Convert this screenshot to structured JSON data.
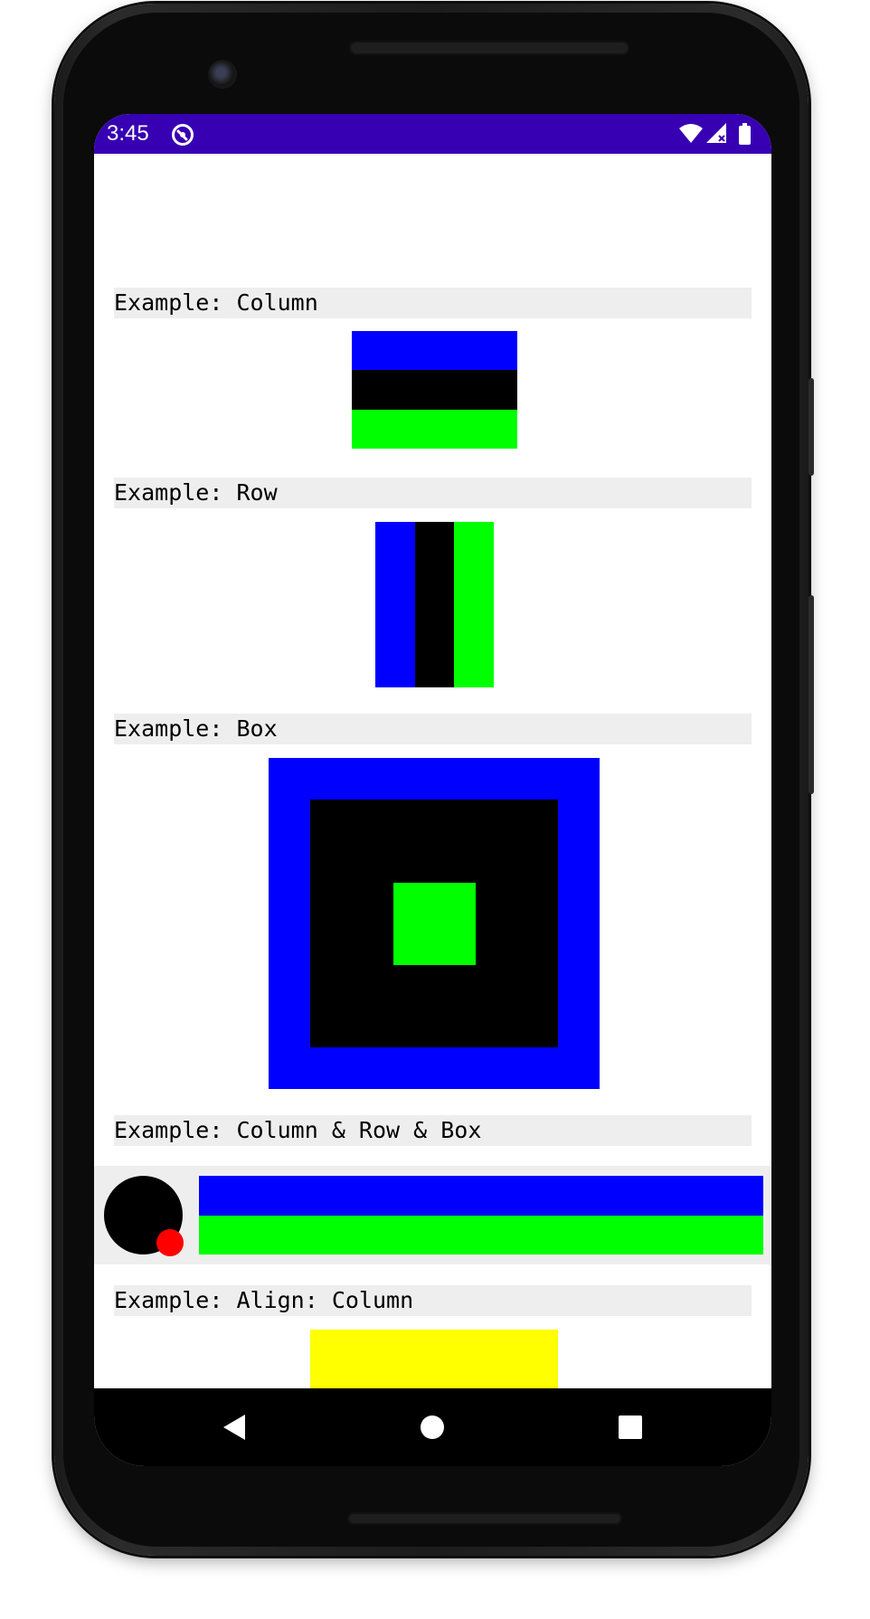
{
  "status_bar": {
    "time": "3:45",
    "color": "#3700B3",
    "app_icon": "app-notification-icon",
    "icons": [
      "wifi-icon",
      "signal-no-data-icon",
      "battery-icon"
    ]
  },
  "sections": {
    "column": {
      "label": "Example: Column",
      "colors": [
        "#0000FF",
        "#000000",
        "#00FF00"
      ]
    },
    "row": {
      "label": "Example: Row",
      "colors": [
        "#0000FF",
        "#000000",
        "#00FF00"
      ]
    },
    "box": {
      "label": "Example: Box",
      "colors": {
        "outer": "#0000FF",
        "middle": "#000000",
        "inner": "#00FF00"
      }
    },
    "combo": {
      "label": "Example: Column & Row & Box",
      "background": "#EEEEEE",
      "avatar_color": "#000000",
      "badge_color": "#FF0000",
      "bars": [
        "#0000FF",
        "#00FF00"
      ]
    },
    "align_column": {
      "label": "Example: Align: Column",
      "colors": {
        "container": "#FFFF00",
        "top": "#FF0000",
        "bottom": "#0000FF"
      }
    }
  },
  "navigation": {
    "back": "back-icon",
    "home": "home-icon",
    "recents": "recents-icon"
  }
}
